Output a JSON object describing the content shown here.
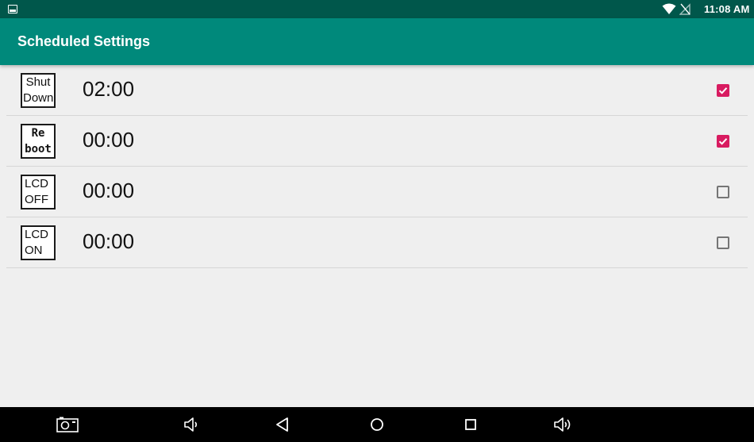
{
  "status_bar": {
    "time": "11:08 AM",
    "icons": [
      "gallery-icon",
      "wifi-icon",
      "no-signal-icon"
    ]
  },
  "app_bar": {
    "title": "Scheduled Settings"
  },
  "schedules": [
    {
      "badge_line1": "Shut",
      "badge_line2": "Down",
      "time": "02:00",
      "enabled": true
    },
    {
      "badge_line1": "Re",
      "badge_line2": "boot",
      "time": "00:00",
      "enabled": true
    },
    {
      "badge_line1": "LCD",
      "badge_line2": "OFF",
      "time": "00:00",
      "enabled": false
    },
    {
      "badge_line1": "LCD",
      "badge_line2": "ON",
      "time": "00:00",
      "enabled": false
    }
  ],
  "nav_bar": {
    "icons": [
      "screenshot-camera-icon",
      "volume-down-icon",
      "back-icon",
      "home-icon",
      "recents-icon",
      "volume-up-icon"
    ]
  },
  "colors": {
    "status_bar": "#00574b",
    "app_bar": "#00897b",
    "checkbox_accent": "#d81b60",
    "background": "#efefef"
  }
}
